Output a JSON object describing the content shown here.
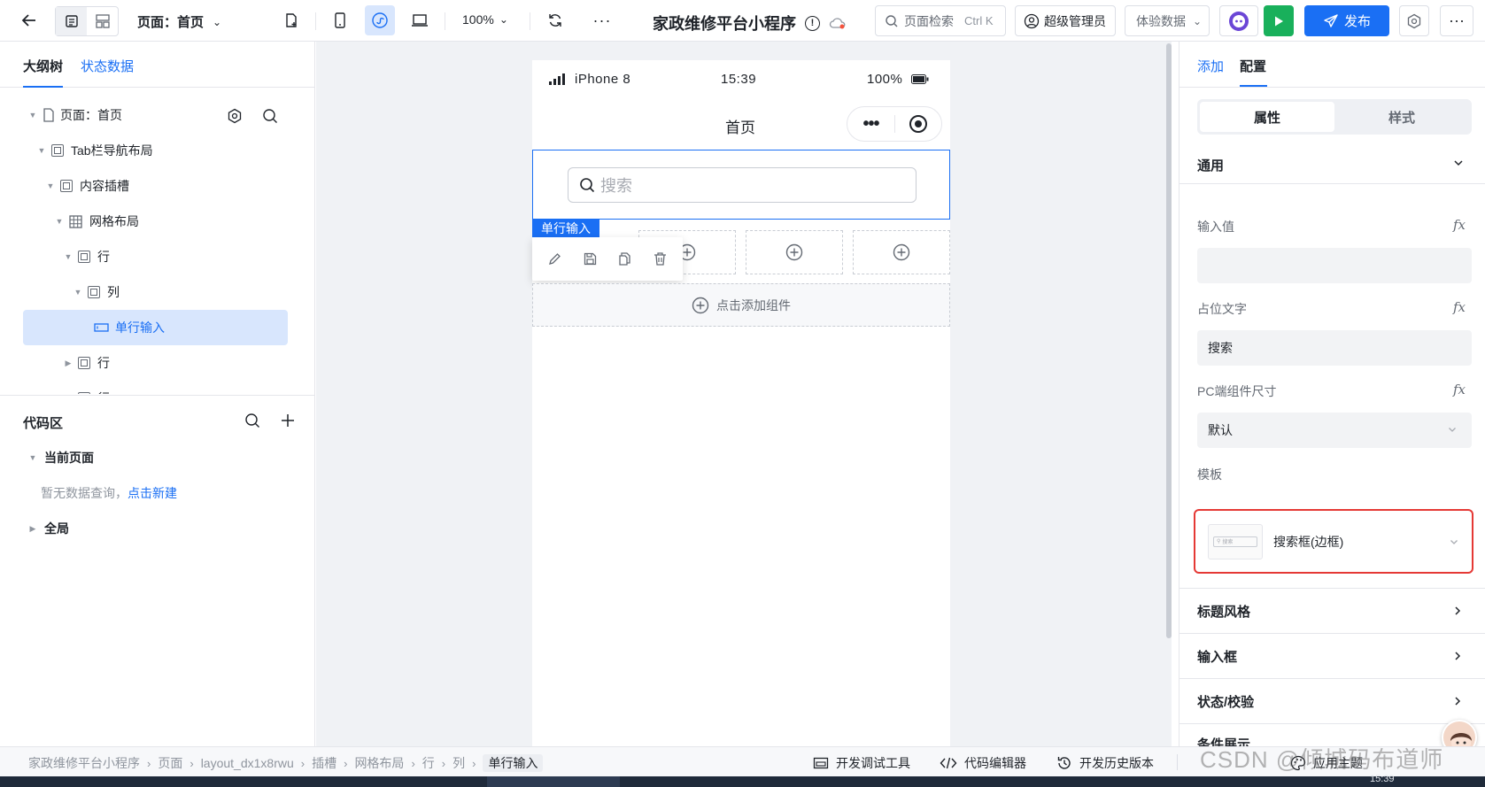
{
  "topbar": {
    "page_selector": "页面：首页",
    "zoom": "100%",
    "app_title": "家政维修平台小程序",
    "search_placeholder": "页面检索",
    "search_shortcut": "Ctrl K",
    "admin_label": "超级管理员",
    "data_env_label": "体验数据",
    "publish_label": "发布",
    "accent": "#1a6ff4",
    "run_color": "#19b05b"
  },
  "left": {
    "tabs": [
      "大纲树",
      "状态数据"
    ],
    "tree": {
      "root": "页面：首页",
      "tab_layout": "Tab栏导航布局",
      "content_slot": "内容插槽",
      "grid_layout": "网格布局",
      "row1": "行",
      "col": "列",
      "single_input": "单行输入",
      "row2": "行",
      "row3": "行"
    },
    "code": {
      "title": "代码区",
      "current_page": "当前页面",
      "empty_text": "暂无数据查询，",
      "create_link": "点击新建",
      "global": "全局"
    }
  },
  "phone": {
    "carrier": "iPhone 8",
    "time": "15:39",
    "battery": "100%",
    "nav_title": "首页",
    "search_placeholder": "搜索",
    "selected_tag": "单行输入",
    "add_component": "点击添加组件"
  },
  "right": {
    "tabs": [
      "添加",
      "配置"
    ],
    "segments": [
      "属性",
      "样式"
    ],
    "general": "通用",
    "input_value_label": "输入值",
    "placeholder_label": "占位文字",
    "placeholder_value": "搜索",
    "pc_size_label": "PC端组件尺寸",
    "pc_size_value": "默认",
    "template_label": "模板",
    "template_value": "搜索框(边框)",
    "template_thumb_text": "搜索",
    "sections": [
      "标题风格",
      "输入框",
      "状态/校验",
      "条件展示"
    ],
    "highlight_color": "#e53935"
  },
  "bottom": {
    "breadcrumb": [
      "家政维修平台小程序",
      "页面",
      "layout_dx1x8rwu",
      "插槽",
      "网格布局",
      "行",
      "列",
      "单行输入"
    ],
    "devtools": "开发调试工具",
    "code_editor": "代码编辑器",
    "history": "开发历史版本",
    "theme": "应用主题"
  },
  "watermark": "CSDN @倾城码布道师",
  "taskbar_time": "15:39"
}
